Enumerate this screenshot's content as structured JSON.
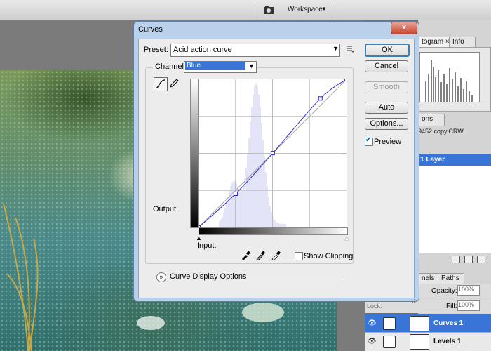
{
  "toolbar": {
    "workspace_label": "Workspace"
  },
  "panels": {
    "histogram_tab": "togram",
    "histogram_close": "×",
    "info_tab": "Info",
    "mini_tab": "ons",
    "filename": "9452 copy.CRW",
    "selected_layer": "1 Layer",
    "channels_tab": "nels",
    "paths_tab": "Paths",
    "opacity_label": "Opacity:",
    "opacity_value": "100%",
    "lock_label": "Lock:",
    "fill_label": "Fill:",
    "fill_value": "100%",
    "layers": [
      {
        "name": "Curves 1",
        "selected": true
      },
      {
        "name": "Levels 1",
        "selected": false
      }
    ]
  },
  "dialog": {
    "title": "Curves",
    "close_label": "x",
    "preset_label": "Preset:",
    "preset_value": "Acid action curve",
    "channel_label": "Channel:",
    "channel_value": "Blue",
    "output_label": "Output:",
    "input_label": "Input:",
    "show_clipping_label": "Show Clipping",
    "curve_display_options_label": "Curve Display Options",
    "buttons": {
      "ok": "OK",
      "cancel": "Cancel",
      "smooth": "Smooth",
      "auto": "Auto",
      "options": "Options..."
    },
    "preview_label": "Preview",
    "preview_checked": true,
    "curve_points": [
      [
        0,
        0
      ],
      [
        64,
        58
      ],
      [
        128,
        128
      ],
      [
        210,
        222
      ],
      [
        255,
        255
      ]
    ]
  },
  "colors": {
    "accent": "#3875d7",
    "curve": "#2b2bd9",
    "histogram": "#c8c8f0"
  }
}
